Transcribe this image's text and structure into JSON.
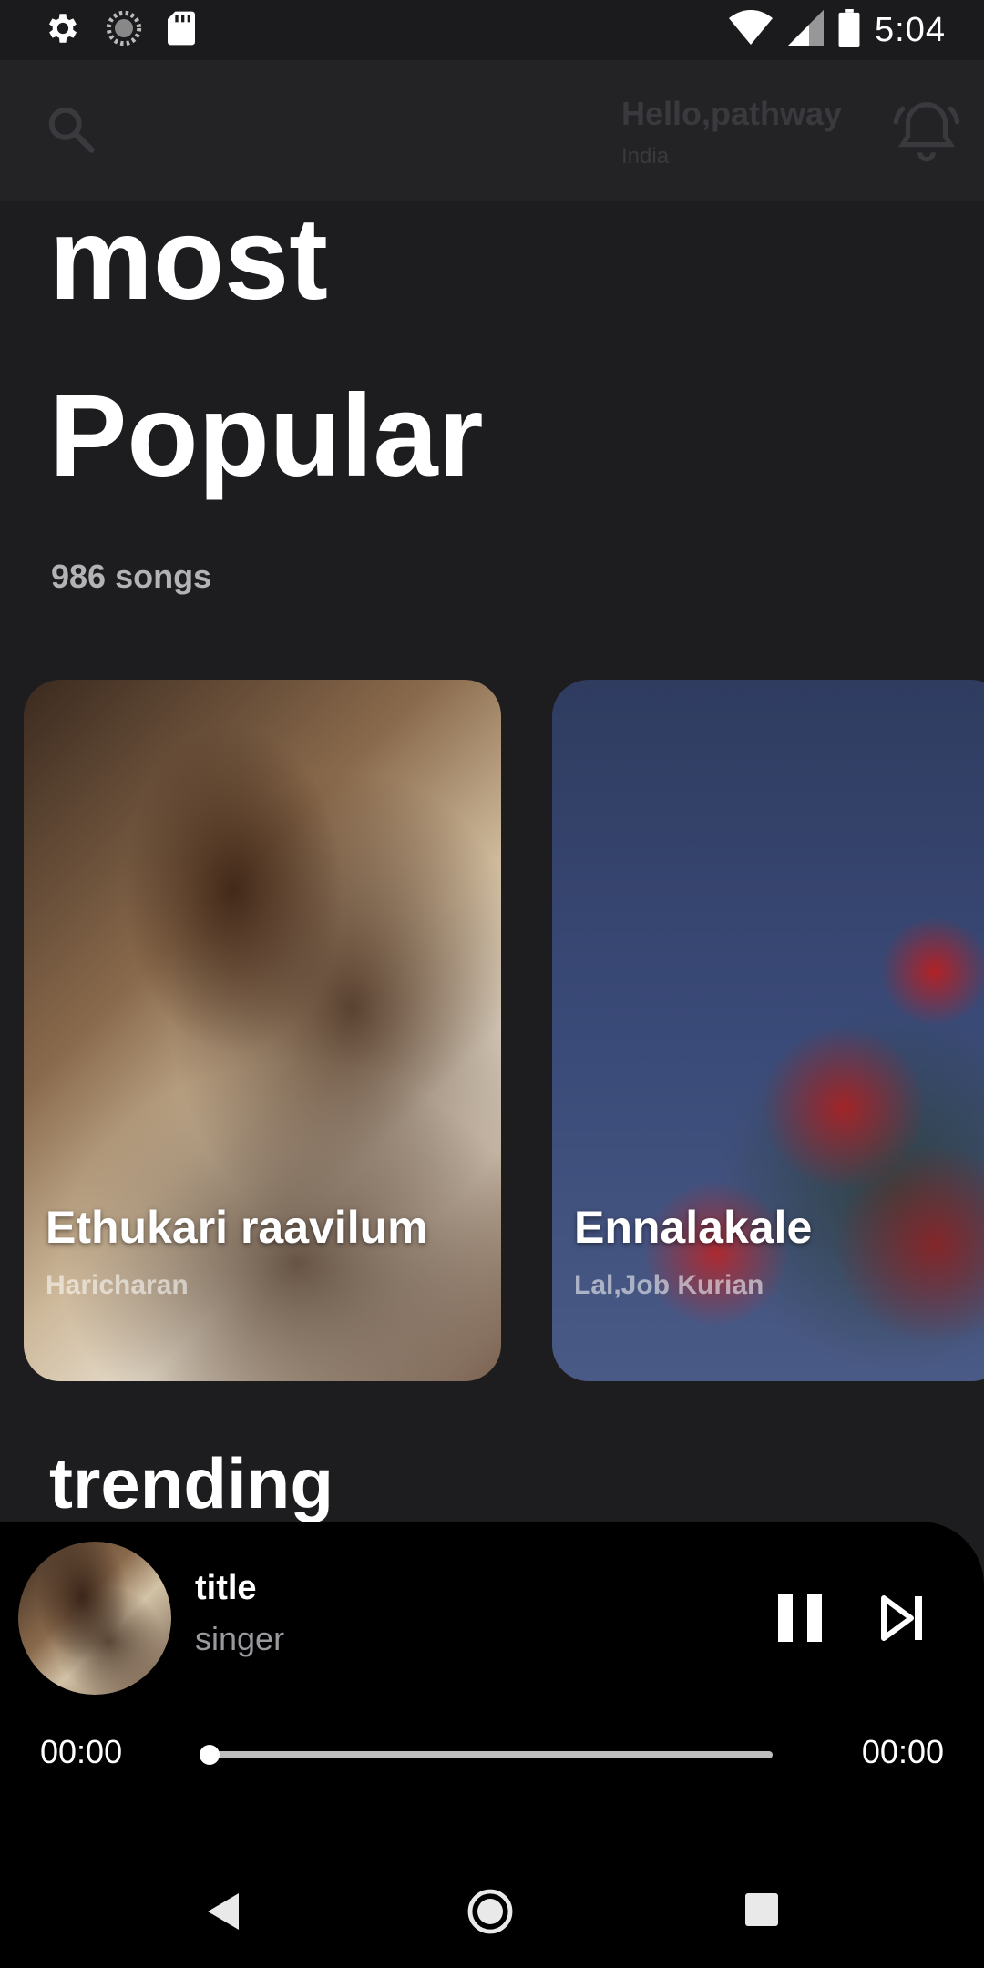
{
  "status_bar": {
    "time": "5:04",
    "icons": [
      "settings-icon",
      "sync-icon",
      "sd-card-icon",
      "wifi-icon",
      "signal-icon",
      "battery-icon"
    ]
  },
  "header": {
    "greeting": "Hello,pathway",
    "location": "India",
    "search_icon": "search-icon",
    "bell_icon": "notification-bell-icon"
  },
  "hero": {
    "title_line1": "most",
    "title_line2": "Popular",
    "song_count": "986 songs"
  },
  "cards": [
    {
      "title": "Ethukari raavilum",
      "artist": "Haricharan"
    },
    {
      "title": "Ennalakale",
      "artist": "Lal,Job Kurian"
    }
  ],
  "sections": {
    "trending": "trending"
  },
  "player": {
    "title": "title",
    "singer": "singer",
    "current_time": "00:00",
    "total_time": "00:00",
    "progress": 0.0
  },
  "colors": {
    "background": "#1d1d1f",
    "header": "#232326",
    "player": "#000000",
    "muted_text": "#b3b3b6"
  }
}
